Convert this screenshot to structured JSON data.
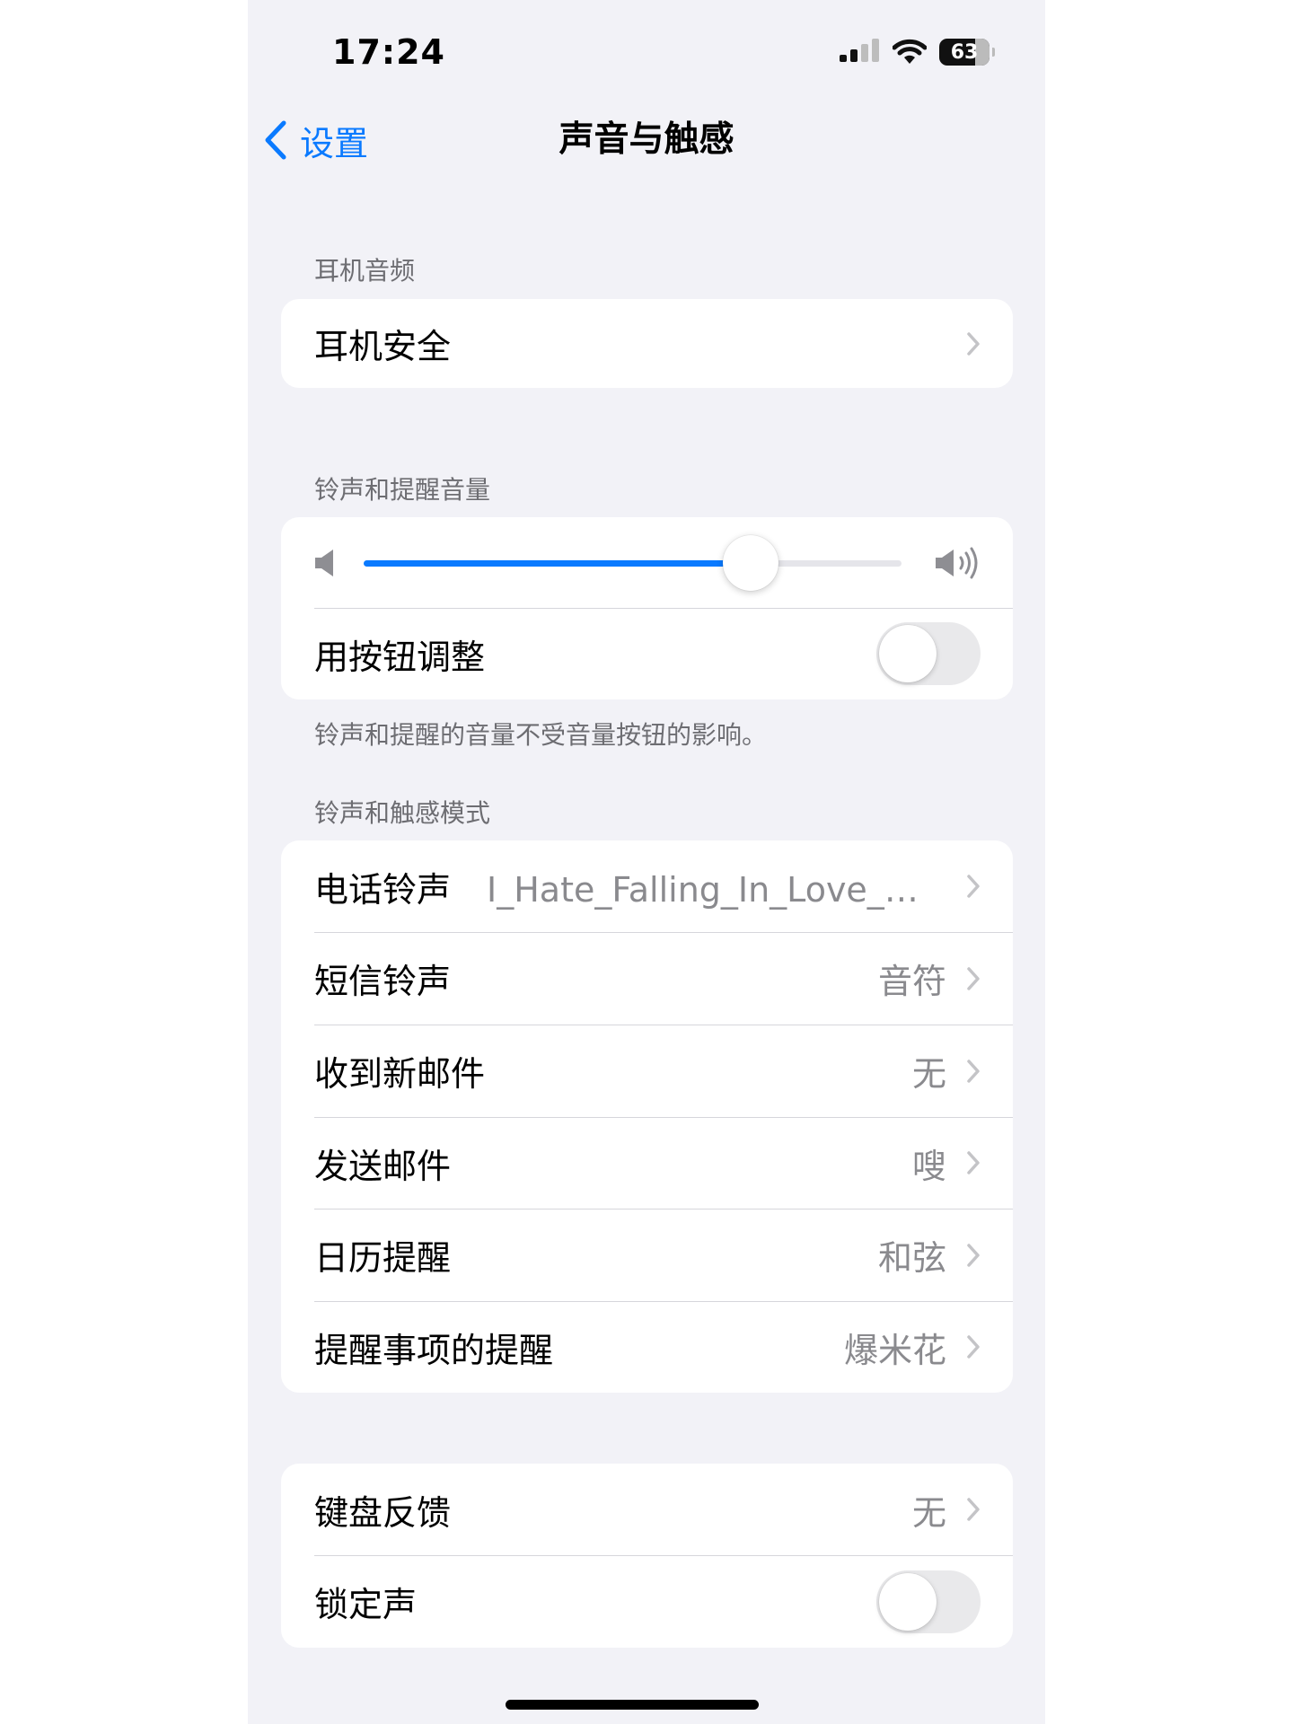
{
  "status_bar": {
    "time": "17:24",
    "battery": "63"
  },
  "nav": {
    "back_label": "设置",
    "title": "声音与触感"
  },
  "sections": {
    "headphone_audio": {
      "header": "耳机音频",
      "rows": [
        {
          "label": "耳机安全"
        }
      ]
    },
    "ringer_volume": {
      "header": "铃声和提醒音量",
      "volume_level": 0.72,
      "change_with_buttons_label": "用按钮调整",
      "change_with_buttons_on": false,
      "footer": "铃声和提醒的音量不受音量按钮的影响。"
    },
    "sounds_patterns": {
      "header": "铃声和触感模式",
      "rows": [
        {
          "label": "电话铃声",
          "value": "I_Hate_Falling_In_Love_史…"
        },
        {
          "label": "短信铃声",
          "value": "音符"
        },
        {
          "label": "收到新邮件",
          "value": "无"
        },
        {
          "label": "发送邮件",
          "value": "嗖"
        },
        {
          "label": "日历提醒",
          "value": "和弦"
        },
        {
          "label": "提醒事项的提醒",
          "value": "爆米花"
        }
      ]
    },
    "feedback": {
      "keyboard_label": "键盘反馈",
      "keyboard_value": "无",
      "lock_sound_label": "锁定声",
      "lock_sound_on": false
    }
  },
  "colors": {
    "accent": "#0a7aff",
    "background": "#f2f2f7",
    "secondary_text": "#8a8a8e",
    "section_text": "#6d6d72"
  }
}
